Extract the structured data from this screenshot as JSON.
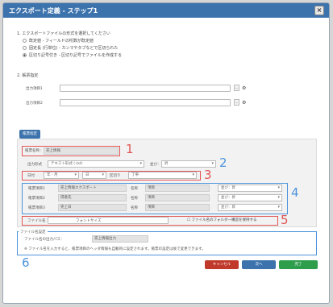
{
  "dialog": {
    "title": "エクスポート定義 - ステップ1",
    "close_label": "×"
  },
  "section1": {
    "heading": "1. エクスポートファイルの形式を選択してください",
    "options": [
      "既定値 - フィールドの桁数が既定値",
      "固定長 (行単位) - カンマやタブなどで区切られた",
      "区切り記号付き - 区切り記号でファイルを作成する"
    ],
    "selected_index": 2
  },
  "section2": {
    "heading": "2. 帳票指定",
    "rows": [
      {
        "label": "出力項目1"
      },
      {
        "label": "出力項目2"
      }
    ]
  },
  "tab_label": "帳票指定",
  "panel": {
    "name_label": "帳票名称：",
    "name_value": "売上情報",
    "row2": {
      "label": "出力形式",
      "value": "テキスト形式 (.txt)",
      "extra_label": "並び：",
      "extra_value": "昇"
    },
    "row3": {
      "label": "日付",
      "v1": "年 - 月",
      "v2": "日",
      "v3": "区切り",
      "v4": "丁寧"
    },
    "fields": [
      {
        "label": "帳票項目1",
        "value": "売上情報エクスポート",
        "k": "名称",
        "v": "項目",
        "o": "並び：昇"
      },
      {
        "label": "帳票項目2",
        "value": "得意先",
        "k": "名称",
        "v": "項目",
        "o": "並び：昇"
      },
      {
        "label": "帳票項目3",
        "value": "売上日",
        "k": "名称",
        "v": "項目",
        "o": "並び：昇"
      }
    ],
    "row5": {
      "label": "ファイル名",
      "value": "フォントサイズ",
      "checkbox_label": "ファイル名のフォルダー構造を保持する"
    }
  },
  "section6": {
    "heading": "ファイル名設定",
    "filename_label": "ファイル名の出力パス：",
    "filename_value": "売上情報出力",
    "note": "※ ファイル名を入力すると、帳票項目のヘッダ情報も自動的に設定されます。帳票の設定は後で変更できます。"
  },
  "buttons": {
    "back": "キャンセル",
    "next": "次へ",
    "finish": "完了"
  },
  "annotations": [
    "1",
    "2",
    "3",
    "4",
    "5",
    "6"
  ]
}
